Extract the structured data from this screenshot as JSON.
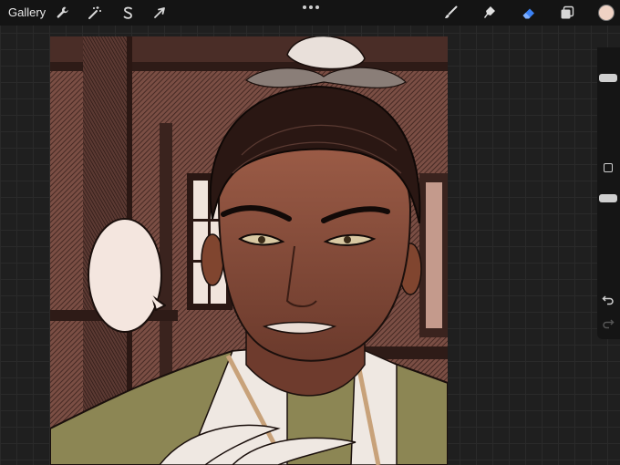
{
  "toolbar": {
    "gallery_label": "Gallery",
    "actions_icon": "wrench-icon",
    "adjustments_icon": "magic-wand-icon",
    "selection_icon": "selection-s-icon",
    "transform_icon": "arrow-cursor-icon",
    "more_icon": "ellipsis-icon",
    "brush_icon": "brush-icon",
    "smudge_icon": "smudge-icon",
    "eraser_icon": "eraser-icon",
    "layers_icon": "layers-icon",
    "current_color": "#efd2c4"
  },
  "sidebar": {
    "brush_size_level": 0.12,
    "opacity_level": 0.2,
    "undo_icon": "undo-icon",
    "redo_icon": "redo-icon"
  },
  "canvas": {
    "background_tone": "#7a4e44",
    "accent": "#c8a27a"
  }
}
